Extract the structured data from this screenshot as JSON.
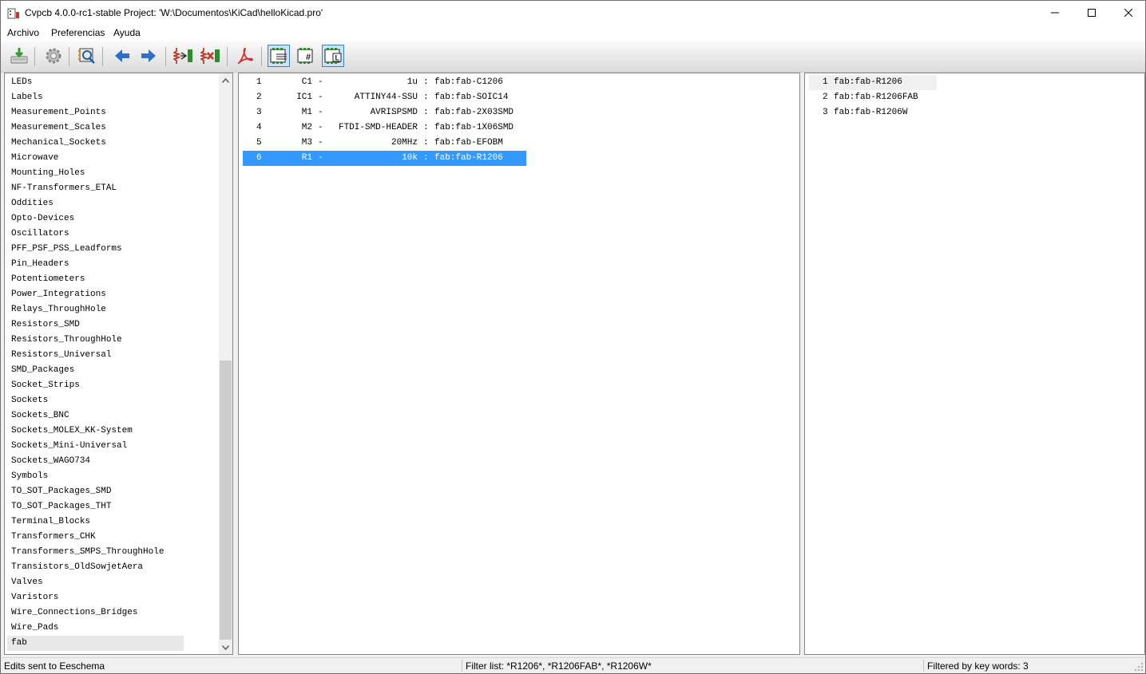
{
  "window": {
    "title": "Cvpcb 4.0.0-rc1-stable  Project: 'W:\\Documentos\\KiCad\\helloKicad.pro'"
  },
  "menu": [
    "Archivo",
    "Preferencias",
    "Ayuda"
  ],
  "toolbar": {
    "icons": [
      "save-to-schematic-icon",
      "settings-icon",
      "view-footprint-icon",
      "previous-icon",
      "next-icon",
      "auto-associate-icon",
      "delete-associations-icon",
      "pdf-icon",
      "filter-keywords-icon",
      "filter-pin-count-icon",
      "filter-library-icon"
    ]
  },
  "libraries": {
    "items": [
      "LEDs",
      "Labels",
      "Measurement_Points",
      "Measurement_Scales",
      "Mechanical_Sockets",
      "Microwave",
      "Mounting_Holes",
      "NF-Transformers_ETAL",
      "Oddities",
      "Opto-Devices",
      "Oscillators",
      "PFF_PSF_PSS_Leadforms",
      "Pin_Headers",
      "Potentiometers",
      "Power_Integrations",
      "Relays_ThroughHole",
      "Resistors_SMD",
      "Resistors_ThroughHole",
      "Resistors_Universal",
      "SMD_Packages",
      "Socket_Strips",
      "Sockets",
      "Sockets_BNC",
      "Sockets_MOLEX_KK-System",
      "Sockets_Mini-Universal",
      "Sockets_WAGO734",
      "Symbols",
      "TO_SOT_Packages_SMD",
      "TO_SOT_Packages_THT",
      "Terminal_Blocks",
      "Transformers_CHK",
      "Transformers_SMPS_ThroughHole",
      "Transistors_OldSowjetAera",
      "Valves",
      "Varistors",
      "Wire_Connections_Bridges",
      "Wire_Pads",
      "fab"
    ],
    "selected": "fab"
  },
  "components": {
    "rows": [
      {
        "num": "1",
        "ref": "C1",
        "sep": "-",
        "value": "1u",
        "colon": ":",
        "footprint": "fab:fab-C1206"
      },
      {
        "num": "2",
        "ref": "IC1",
        "sep": "-",
        "value": "ATTINY44-SSU",
        "colon": ":",
        "footprint": "fab:fab-SOIC14"
      },
      {
        "num": "3",
        "ref": "M1",
        "sep": "-",
        "value": "AVRISPSMD",
        "colon": ":",
        "footprint": "fab:fab-2X03SMD"
      },
      {
        "num": "4",
        "ref": "M2",
        "sep": "-",
        "value": "FTDI-SMD-HEADER",
        "colon": ":",
        "footprint": "fab:fab-1X06SMD"
      },
      {
        "num": "5",
        "ref": "M3",
        "sep": "-",
        "value": "20MHz",
        "colon": ":",
        "footprint": "fab:fab-EFOBM"
      },
      {
        "num": "6",
        "ref": "R1",
        "sep": "-",
        "value": "10k",
        "colon": ":",
        "footprint": "fab:fab-R1206"
      }
    ],
    "selected_index": 5
  },
  "footprints": {
    "rows": [
      {
        "num": "1",
        "name": "fab:fab-R1206"
      },
      {
        "num": "2",
        "name": "fab:fab-R1206FAB"
      },
      {
        "num": "3",
        "name": "fab:fab-R1206W"
      }
    ],
    "selected_index": 0
  },
  "status": {
    "left": "Edits sent to Eeschema",
    "middle": "Filter list: *R1206*, *R1206FAB*, *R1206W*",
    "right": "Filtered by key words: 3"
  },
  "colors": {
    "selection": "#3399ff",
    "toggle_bg": "#cce4f7"
  }
}
